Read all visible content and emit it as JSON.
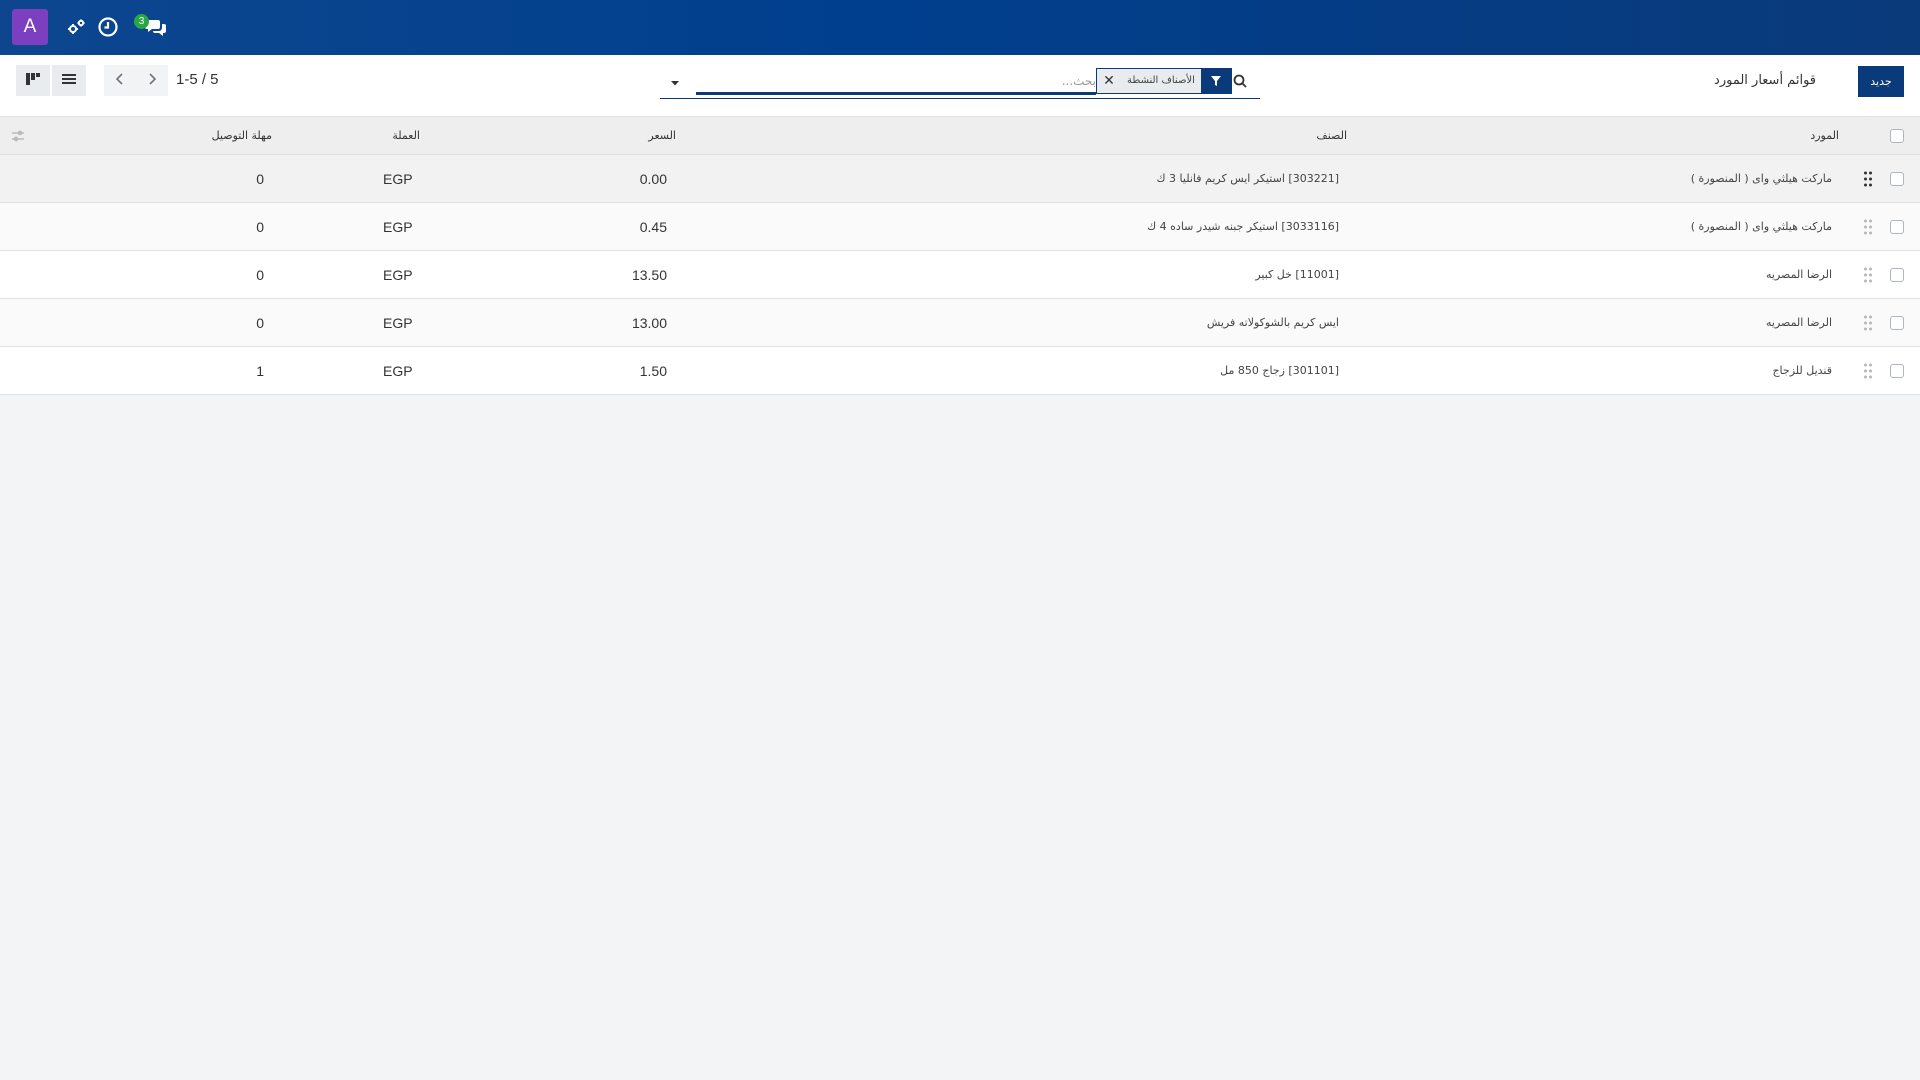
{
  "navbar": {
    "avatar_letter": "A",
    "icons": [
      "settings-icon",
      "clock-icon",
      "chat-icon"
    ],
    "chat_badge": "3",
    "background": "#003f8e"
  },
  "control": {
    "new_button": "جديد",
    "breadcrumb": "قوائم أسعار المورد",
    "search_placeholder": "بحث...",
    "facet_value": "الأصناف النشطة",
    "pager_value": "1-5 / 5"
  },
  "table": {
    "headers": {
      "vendor": "المورد",
      "product": "الصنف",
      "price": "السعر",
      "currency": "العملة",
      "delivery_lead_time": "مهلة التوصيل"
    },
    "rows": [
      {
        "vendor": "ماركت هيلثي واى ( المنصورة )",
        "product": "[303221] استيكر ايس كريم فانليا 3 ك",
        "price": "0.00",
        "currency": "EGP",
        "delay": "0"
      },
      {
        "vendor": "ماركت هيلثي واى ( المنصورة )",
        "product": "[3033116] استيكر جبنه شيدر ساده 4 ك",
        "price": "0.45",
        "currency": "EGP",
        "delay": "0"
      },
      {
        "vendor": "الرضا المصريه",
        "product": "[11001] خل كبير",
        "price": "13.50",
        "currency": "EGP",
        "delay": "0"
      },
      {
        "vendor": "الرضا المصريه",
        "product": "ايس كريم بالشوكولاته فريش",
        "price": "13.00",
        "currency": "EGP",
        "delay": "0"
      },
      {
        "vendor": "قنديل للزجاج",
        "product": "[301101] زجاج 850 مل",
        "price": "1.50",
        "currency": "EGP",
        "delay": "1"
      }
    ]
  }
}
